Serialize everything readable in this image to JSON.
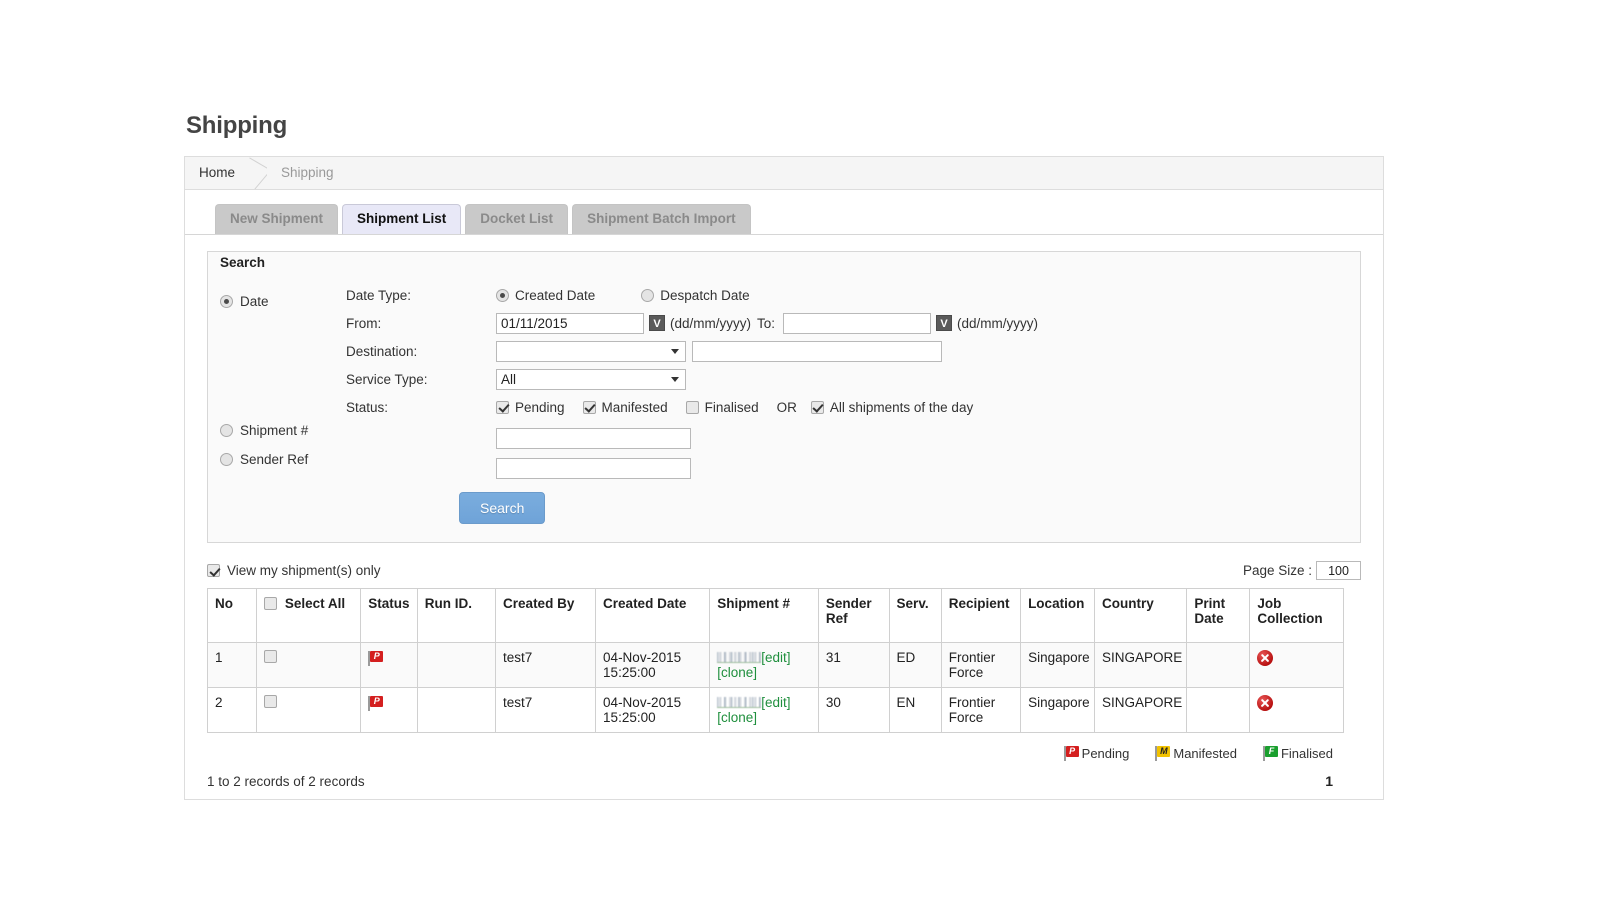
{
  "page": {
    "title": "Shipping"
  },
  "breadcrumb": {
    "home": "Home",
    "current": "Shipping"
  },
  "tabs": [
    {
      "label": "New Shipment",
      "active": false
    },
    {
      "label": "Shipment List",
      "active": true
    },
    {
      "label": "Docket List",
      "active": false
    },
    {
      "label": "Shipment Batch Import",
      "active": false
    }
  ],
  "search": {
    "legend": "Search",
    "mode_date_label": "Date",
    "mode_shipment_label": "Shipment #",
    "mode_sender_label": "Sender Ref",
    "selected_mode": "Date",
    "date_type_label": "Date Type:",
    "created_date_label": "Created Date",
    "despatch_date_label": "Despatch Date",
    "selected_date_type": "Created Date",
    "from_label": "From:",
    "from_value": "01/11/2015",
    "from_format": "(dd/mm/yyyy)",
    "to_label": "To:",
    "to_value": "",
    "to_format": "(dd/mm/yyyy)",
    "calendar_glyph": "V",
    "destination_label": "Destination:",
    "destination_value": "",
    "destination_text_value": "",
    "service_type_label": "Service Type:",
    "service_type_value": "All",
    "status_label": "Status:",
    "status_options": [
      {
        "label": "Pending",
        "checked": true
      },
      {
        "label": "Manifested",
        "checked": true
      },
      {
        "label": "Finalised",
        "checked": false
      }
    ],
    "or_label": "OR",
    "all_shipments_label": "All shipments of the day",
    "all_shipments_checked": true,
    "shipment_number_value": "",
    "sender_ref_value": "",
    "search_button": "Search"
  },
  "toolbar": {
    "view_my_shipments_label": "View my shipment(s) only",
    "view_my_shipments_checked": true,
    "page_size_label": "Page Size :",
    "page_size_value": "100"
  },
  "table": {
    "columns": [
      "No",
      "Select All",
      "Status",
      "Run ID.",
      "Created By",
      "Created Date",
      "Shipment #",
      "Sender Ref",
      "Serv.",
      "Recipient",
      "Location",
      "Country",
      "Print Date",
      "Job Collection"
    ],
    "select_all_label": "Select All",
    "edit_label": "[edit]",
    "clone_label": "[clone]",
    "rows": [
      {
        "no": "1",
        "selected": false,
        "status": "pending",
        "run_id": "",
        "created_by": "test7",
        "created_date": "04-Nov-2015 15:25:00",
        "shipment_number": "",
        "sender_ref": "31",
        "serv": "ED",
        "recipient": "Frontier Force",
        "location": "Singapore",
        "country": "SINGAPORE",
        "print_date": "",
        "job_collection": "delete"
      },
      {
        "no": "2",
        "selected": false,
        "status": "pending",
        "run_id": "",
        "created_by": "test7",
        "created_date": "04-Nov-2015 15:25:00",
        "shipment_number": "",
        "sender_ref": "30",
        "serv": "EN",
        "recipient": "Frontier Force",
        "location": "Singapore",
        "country": "SINGAPORE",
        "print_date": "",
        "job_collection": "delete"
      }
    ]
  },
  "legend": [
    {
      "glyph": "P",
      "label": "Pending",
      "color": "#d41f1f"
    },
    {
      "glyph": "M",
      "label": "Manifested",
      "color": "#f2c200"
    },
    {
      "glyph": "F",
      "label": "Finalised",
      "color": "#1a9f2e"
    }
  ],
  "footer": {
    "records_text": "1 to 2 records of 2 records",
    "current_page": "1"
  }
}
